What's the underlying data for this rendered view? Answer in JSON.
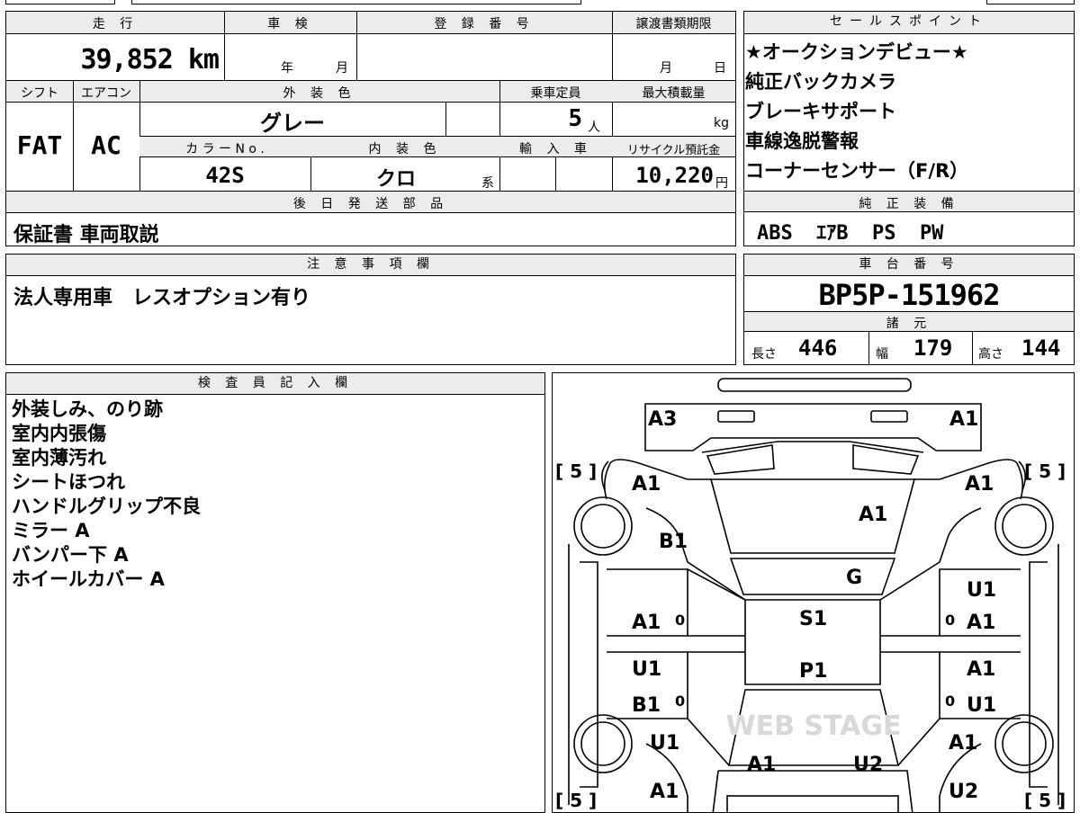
{
  "sheet": {
    "mileage": {
      "header": "走 行",
      "value": "39,852 km"
    },
    "inspection": {
      "header": "車 検",
      "year_label": "年",
      "month_label": "月"
    },
    "registration": {
      "header": "登 録 番 号"
    },
    "transfer_deadline": {
      "header": "譲渡書類期限",
      "month_label": "月",
      "day_label": "日"
    },
    "shift": {
      "header": "シフト",
      "value": "FAT"
    },
    "aircon": {
      "header": "エアコン",
      "value": "AC"
    },
    "exterior_color": {
      "header": "外 装 色",
      "value": "グレー"
    },
    "capacity": {
      "header": "乗車定員",
      "value": "5",
      "unit": "人"
    },
    "max_load": {
      "header": "最大積載量",
      "unit": "kg"
    },
    "color_no": {
      "header": "カ ラ ー N o .",
      "value": "42S"
    },
    "interior_color": {
      "header": "内 装 色",
      "value": "クロ",
      "suffix": "系"
    },
    "import": {
      "header": "輸 入 車"
    },
    "recycle": {
      "header": "リサイクル預託金",
      "value": "10,220",
      "unit": "円"
    },
    "later_parts": {
      "header": "後 日 発 送 部 品",
      "value": "保証書 車両取説"
    },
    "notes": {
      "header": "注 意 事 項 欄",
      "value": "法人専用車　レスオプション有り"
    }
  },
  "sales_points": {
    "header": "セールスポイント",
    "items": [
      "★オークションデビュー★",
      "純正バックカメラ",
      "ブレーキサポート",
      "車線逸脱警報",
      "コーナーセンサー（F/R）"
    ]
  },
  "standard_equipment": {
    "header": "純 正 装 備",
    "value": "ABS  ｴｱB  PS  PW"
  },
  "chassis": {
    "header": "車 台 番 号",
    "value": "BP5P-151962"
  },
  "specs": {
    "header": "諸 元",
    "length_label": "長さ",
    "length": "446",
    "width_label": "幅",
    "width": "179",
    "height_label": "高さ",
    "height": "144"
  },
  "inspector": {
    "header": "検 査 員 記 入 欄",
    "lines": [
      "外装しみ、のり跡",
      "室内内張傷",
      "室内薄汚れ",
      "シートほつれ",
      "ハンドルグリップ不良",
      "ミラー A",
      "バンパー下 A",
      "ホイールカバー A"
    ]
  },
  "diagram": {
    "tires": {
      "front_left": "[ 5 ]",
      "front_right": "[ 5 ]",
      "rear_left": "[ 5 ]",
      "rear_right": "[ 5 ]"
    },
    "marks": {
      "trunk_left": "A3",
      "trunk_right": "A1",
      "rear_fender_left": "A1",
      "rear_fender_right": "A1",
      "rear_window": "A1",
      "rear_pillar_left": "B1",
      "roof_glass": "G",
      "roof": "S1",
      "rear_door_left": "A1",
      "rear_door_right_top": "U1",
      "rear_door_right": "A1",
      "hood": "P1",
      "front_door_left_top": "U1",
      "front_door_left": "B1",
      "front_door_right_top": "A1",
      "front_door_right": "U1",
      "front_fender_left": "U1",
      "front_fender_right": "A1",
      "front_left": "A1",
      "front_right": "U2",
      "front_bumper_left": "A1",
      "front_bumper_right": "U2",
      "zero_1": "0",
      "zero_2": "0",
      "zero_3": "0",
      "zero_4": "0"
    },
    "watermark": "WEB STAGE"
  }
}
